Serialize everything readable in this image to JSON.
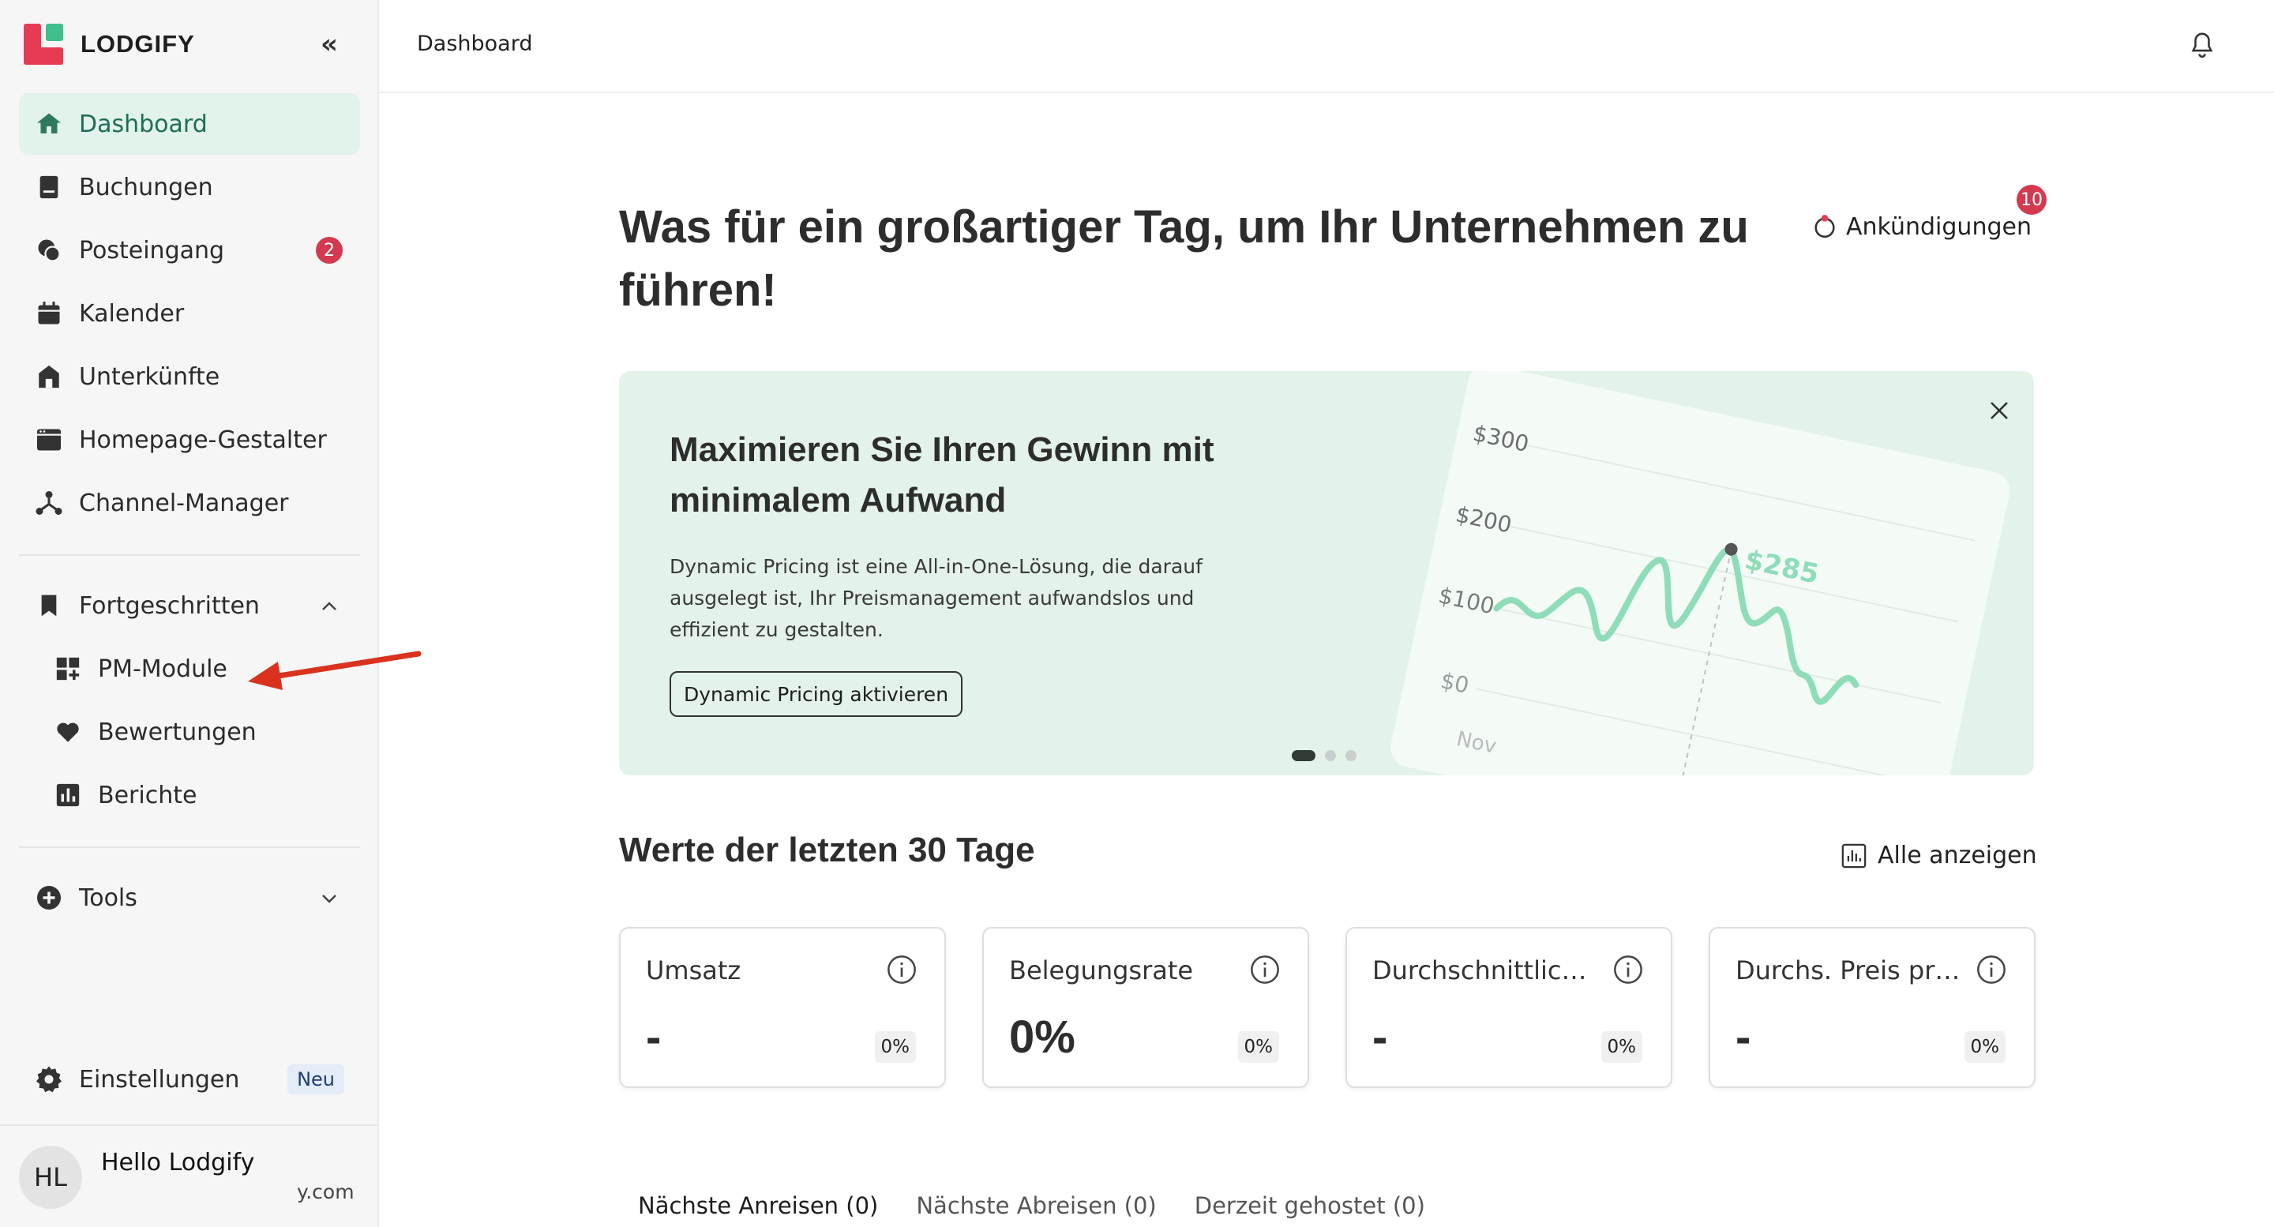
{
  "brand": {
    "name": "LODGIFY",
    "colors": {
      "red": "#e63b52",
      "green": "#3fbf8c",
      "active_bg": "#e2f3ec",
      "active_text": "#1f6e54"
    }
  },
  "sidebar": {
    "collapse_label": "«",
    "items": [
      {
        "label": "Dashboard",
        "icon": "home-icon",
        "active": true
      },
      {
        "label": "Buchungen",
        "icon": "book-icon"
      },
      {
        "label": "Posteingang",
        "icon": "chat-icon",
        "badge": "2"
      },
      {
        "label": "Kalender",
        "icon": "calendar-icon"
      },
      {
        "label": "Unterkünfte",
        "icon": "house-icon"
      },
      {
        "label": "Homepage-Gestalter",
        "icon": "browser-icon"
      },
      {
        "label": "Channel-Manager",
        "icon": "network-icon"
      }
    ],
    "advanced": {
      "label": "Fortgeschritten",
      "icon": "bookmark-icon",
      "expanded": true,
      "items": [
        {
          "label": "PM-Module",
          "icon": "modules-icon"
        },
        {
          "label": "Bewertungen",
          "icon": "heart-icon"
        },
        {
          "label": "Berichte",
          "icon": "bar-chart-icon"
        }
      ]
    },
    "tools": {
      "label": "Tools",
      "icon": "plus-circle-icon",
      "expanded": false
    },
    "settings": {
      "label": "Einstellungen",
      "icon": "gear-icon",
      "badge": "Neu"
    },
    "user": {
      "initials": "HL",
      "name": "Hello Lodgify",
      "email_fragment": "y.com"
    }
  },
  "topbar": {
    "breadcrumb": "Dashboard",
    "icon": "bell-icon"
  },
  "main": {
    "headline": "Was für ein großartiger Tag, um Ihr Unternehmen zu führen!",
    "announcements": {
      "label": "Ankündigungen",
      "count": "10"
    },
    "banner": {
      "title": "Maximieren Sie Ihren Gewinn mit minimalem Aufwand",
      "text": "Dynamic Pricing ist eine All-in-One-Lösung, die darauf ausgelegt ist, Ihr Preismanagement aufwandslos und effizient zu gestalten.",
      "button": "Dynamic Pricing aktivieren",
      "chart_labels": {
        "y300": "$300",
        "y200": "$200",
        "y100": "$100",
        "y0": "$0",
        "x": "Nov",
        "highlight": "$285"
      },
      "carousel_active": 1,
      "carousel_count": 3
    },
    "stats": {
      "title": "Werte der letzten 30 Tage",
      "show_all": "Alle anzeigen",
      "cards": [
        {
          "label": "Umsatz",
          "value": "-",
          "change": "0%"
        },
        {
          "label": "Belegungsrate",
          "value": "0%",
          "change": "0%"
        },
        {
          "label": "Durchschnittlic…",
          "value": "-",
          "change": "0%"
        },
        {
          "label": "Durchs. Preis pr…",
          "value": "-",
          "change": "0%"
        }
      ]
    },
    "tabs": [
      {
        "label": "Nächste Anreisen (0)",
        "active": true
      },
      {
        "label": "Nächste Abreisen (0)"
      },
      {
        "label": "Derzeit gehostet (0)"
      }
    ]
  }
}
